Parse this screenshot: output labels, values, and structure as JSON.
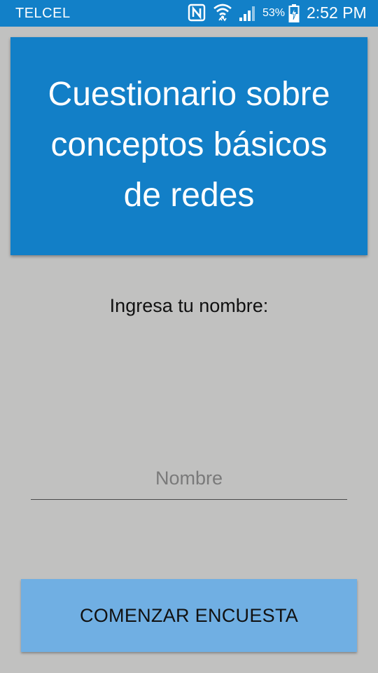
{
  "status_bar": {
    "carrier": "TELCEL",
    "battery_percent": "53%",
    "time": "2:52 PM",
    "icons": [
      "nfc-icon",
      "wifi-icon",
      "signal-icon",
      "battery-charging-icon"
    ]
  },
  "header": {
    "title": "Cuestionario sobre conceptos básicos de redes"
  },
  "form": {
    "name_label": "Ingresa tu nombre:",
    "name_placeholder": "Nombre",
    "name_value": ""
  },
  "actions": {
    "start_label": "COMENZAR ENCUESTA"
  },
  "colors": {
    "primary": "#127fc7",
    "button": "#70afe3",
    "background": "#c1c1c0"
  }
}
